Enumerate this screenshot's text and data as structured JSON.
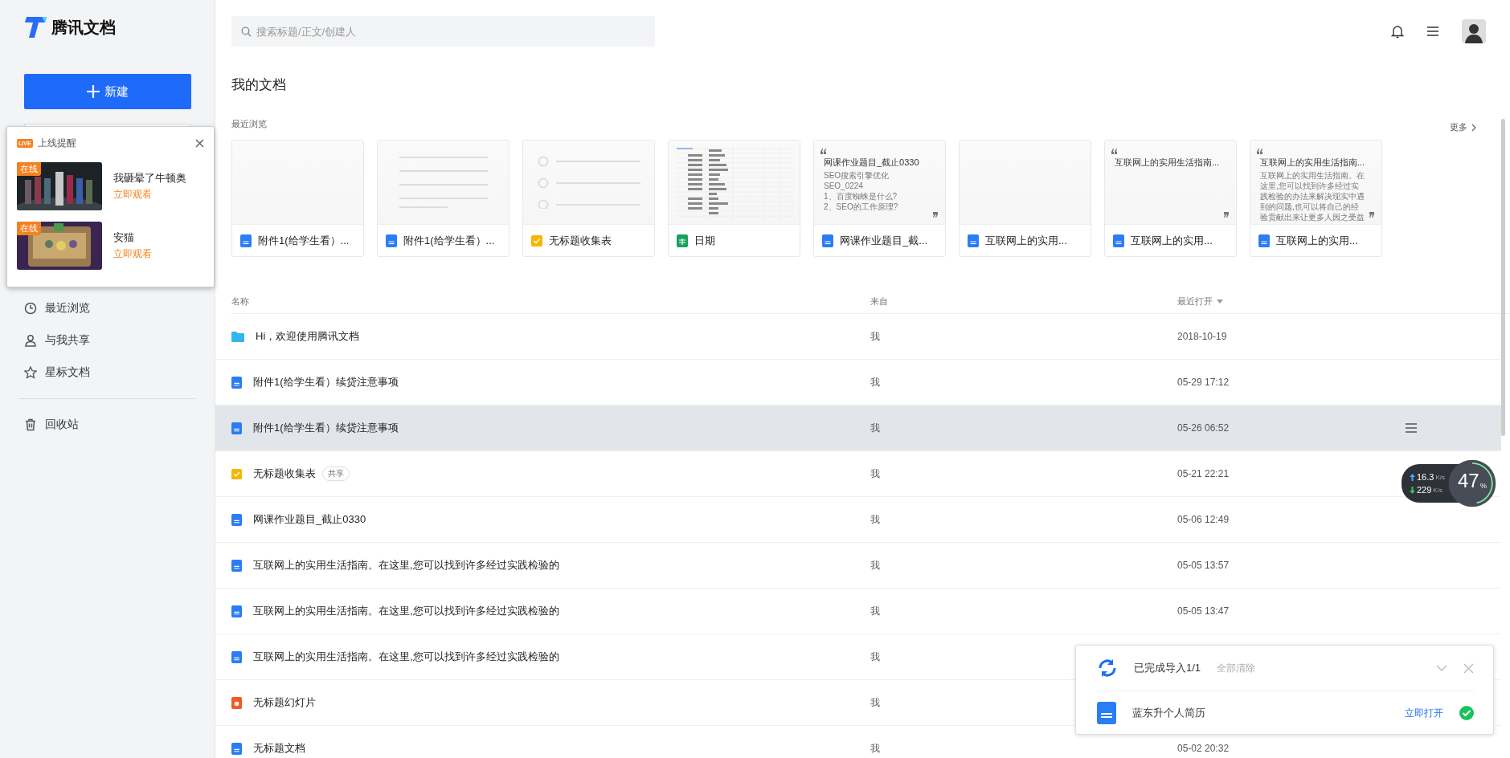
{
  "sidebar": {
    "logo": "腾讯文档",
    "new_button": "新建",
    "items": [
      {
        "label": "最近浏览",
        "selected": false
      },
      {
        "label": "与我共享",
        "selected": false
      },
      {
        "label": "星标文档",
        "selected": false
      },
      {
        "label": "回收站",
        "selected": false
      }
    ]
  },
  "live_popup": {
    "badge": "LIVE",
    "title": "上线提醒",
    "items": [
      {
        "tag": "在线",
        "name": "我砸晕了牛顿奥",
        "action": "立即观看",
        "kind": "picture"
      },
      {
        "tag": "在线",
        "name": "安猫",
        "action": "立即观看",
        "kind": "picture"
      }
    ]
  },
  "search": {
    "placeholder": "搜索标题/正文/创建人"
  },
  "heading": "我的文档",
  "recent": {
    "label": "最近浏览",
    "more": "更多",
    "cards": [
      {
        "kind": "blank",
        "name": "附件1(给学生看）..."
      },
      {
        "kind": "lines",
        "name": "附件1(给学生看）..."
      },
      {
        "kind": "form",
        "name": "无标题收集表"
      },
      {
        "kind": "sheet",
        "name": "日期"
      },
      {
        "kind": "quote",
        "name": "网课作业题目_截...",
        "quote_title": "网课作业题目_截止0330",
        "quote_lines": [
          "SEO搜索引擎优化",
          "SEO_0224",
          "1、百度蜘蛛是什么?",
          "2、SEO的工作原理?"
        ]
      },
      {
        "kind": "blank",
        "name": "互联网上的实用..."
      },
      {
        "kind": "quote",
        "name": "互联网上的实用...",
        "quote_title": "互联网上的实用生活指南..."
      },
      {
        "kind": "quote",
        "name": "互联网上的实用...",
        "quote_title": "互联网上的实用生活指南...",
        "quote_lines": [
          "互联网上的实用生活指南。在这里,您可以找到许多经过实践检验的办法来解决现实中遇到的问题,也可以将自己的经验贡献出来让更多人因之受益"
        ]
      }
    ]
  },
  "table": {
    "columns": [
      "名称",
      "来自",
      "最近打开"
    ],
    "rows": [
      {
        "kind": "folder",
        "name": "Hi，欢迎使用腾讯文档",
        "from": "我",
        "opened": "2018-10-19",
        "hovered": false
      },
      {
        "kind": "doc",
        "name": "附件1(给学生看）续贷注意事项",
        "from": "我",
        "opened": "05-29 17:12",
        "hovered": false
      },
      {
        "kind": "doc",
        "name": "附件1(给学生看）续贷注意事项",
        "from": "我",
        "opened": "05-26 06:52",
        "hovered": true
      },
      {
        "kind": "form",
        "name": "无标题收集表",
        "tag": "共享",
        "from": "我",
        "opened": "05-21 22:21",
        "hovered": false
      },
      {
        "kind": "doc",
        "name": "网课作业题目_截止0330",
        "from": "我",
        "opened": "05-06 12:49",
        "hovered": false
      },
      {
        "kind": "doc",
        "name": "互联网上的实用生活指南。在这里,您可以找到许多经过实践检验的",
        "from": "我",
        "opened": "05-05 13:57",
        "hovered": false
      },
      {
        "kind": "doc",
        "name": "互联网上的实用生活指南。在这里,您可以找到许多经过实践检验的",
        "from": "我",
        "opened": "05-05 13:47",
        "hovered": false
      },
      {
        "kind": "doc",
        "name": "互联网上的实用生活指南。在这里,您可以找到许多经过实践检验的",
        "from": "我",
        "hovered": false
      },
      {
        "kind": "slide",
        "name": "无标题幻灯片",
        "from": "我",
        "hovered": false
      },
      {
        "kind": "doc",
        "name": "无标题文档",
        "from": "我",
        "opened": "05-02 20:32",
        "hovered": false
      }
    ]
  },
  "import_panel": {
    "status": "已完成导入1/1",
    "clear": "全部清除",
    "file": "蓝东升个人简历",
    "open": "立即打开"
  },
  "net_meter": {
    "up": "16.3",
    "down": "229",
    "unit_up": "K/s",
    "unit_down": "K/s",
    "percent": "47",
    "percent_sign": "%"
  }
}
